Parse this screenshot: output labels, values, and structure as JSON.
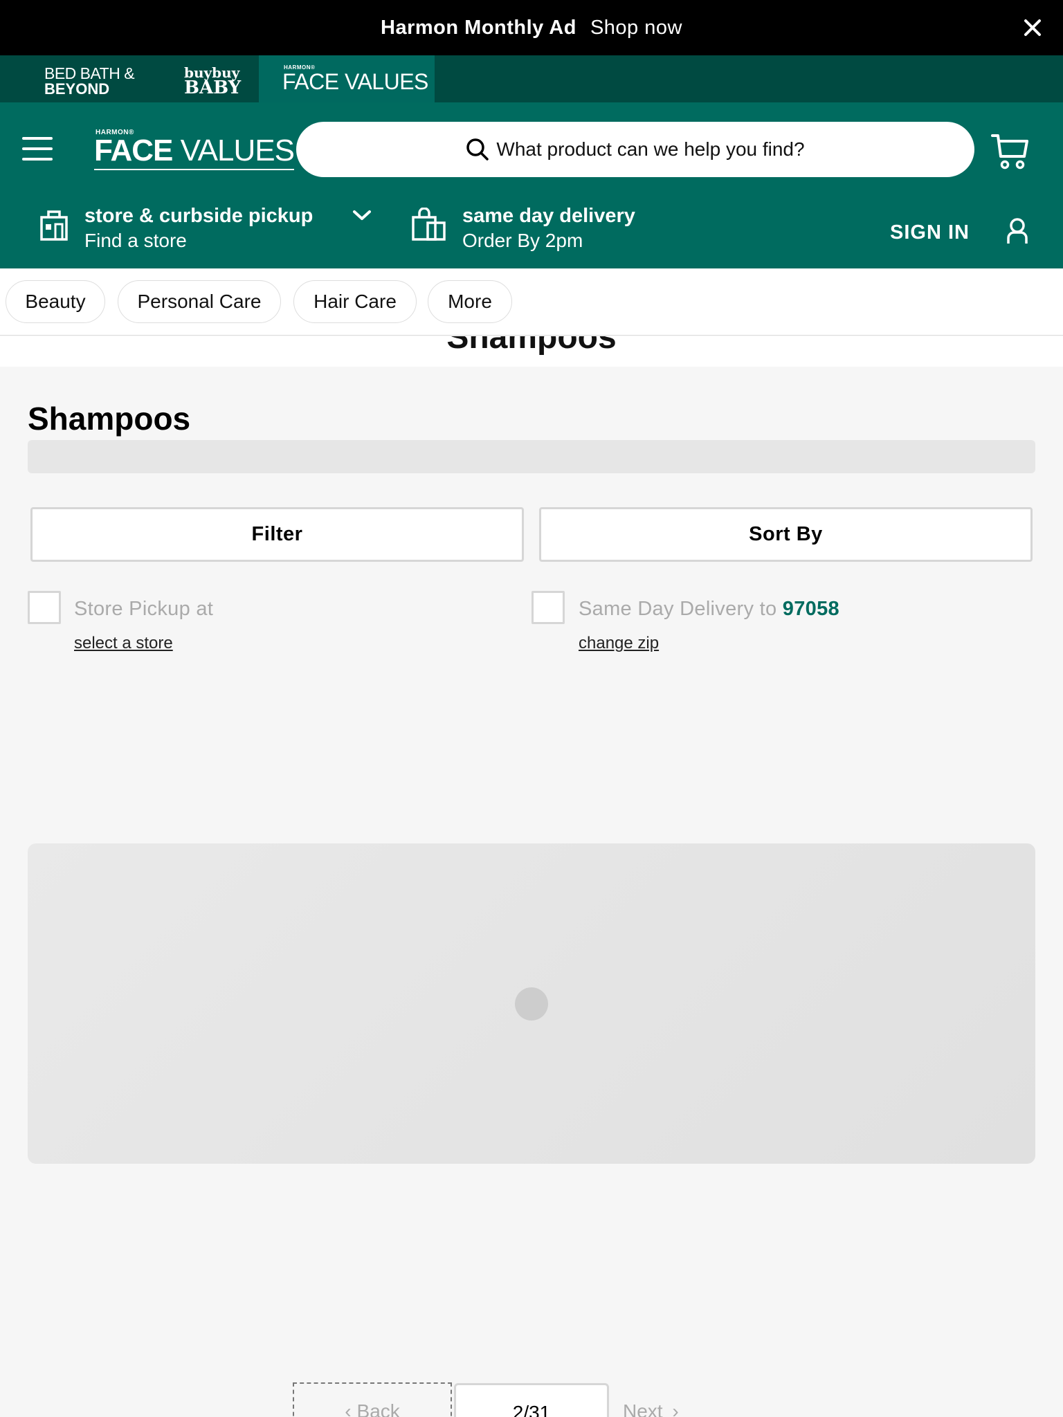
{
  "promo": {
    "bold": "Harmon Monthly Ad",
    "link": "Shop now"
  },
  "brands": {
    "bbb_line1": "BED BATH &",
    "bbb_line2": "BEYOND",
    "baby_line1": "buybuy",
    "baby_line2": "BABY",
    "fv_tiny": "HARMON®",
    "fv_main": "FACE VALUES"
  },
  "header": {
    "logo_tiny": "HARMON®",
    "logo_bold": "FACE",
    "logo_rest": " VALUES",
    "search_placeholder": "What product can we help you find?",
    "pickup_title": "store & curbside pickup",
    "pickup_sub": "Find a store",
    "delivery_title": "same day delivery",
    "delivery_sub": "Order By 2pm",
    "signin": "SIGN IN"
  },
  "categories": [
    "Beauty",
    "Personal Care",
    "Hair Care",
    "More"
  ],
  "sticky_title": "Shampoos",
  "page_title": "Shampoos",
  "buttons": {
    "filter": "Filter",
    "sort": "Sort By"
  },
  "store_pickup": {
    "label": "Store Pickup at",
    "link": "select a store"
  },
  "same_day": {
    "label": "Same Day Delivery to",
    "zip": "97058",
    "link": "change zip"
  },
  "pagination": {
    "back": "Back",
    "page": "2/31",
    "next": "Next"
  },
  "colors": {
    "brand_green": "#006b5f",
    "brand_dark": "#004a41",
    "promo_bg": "#000000"
  }
}
